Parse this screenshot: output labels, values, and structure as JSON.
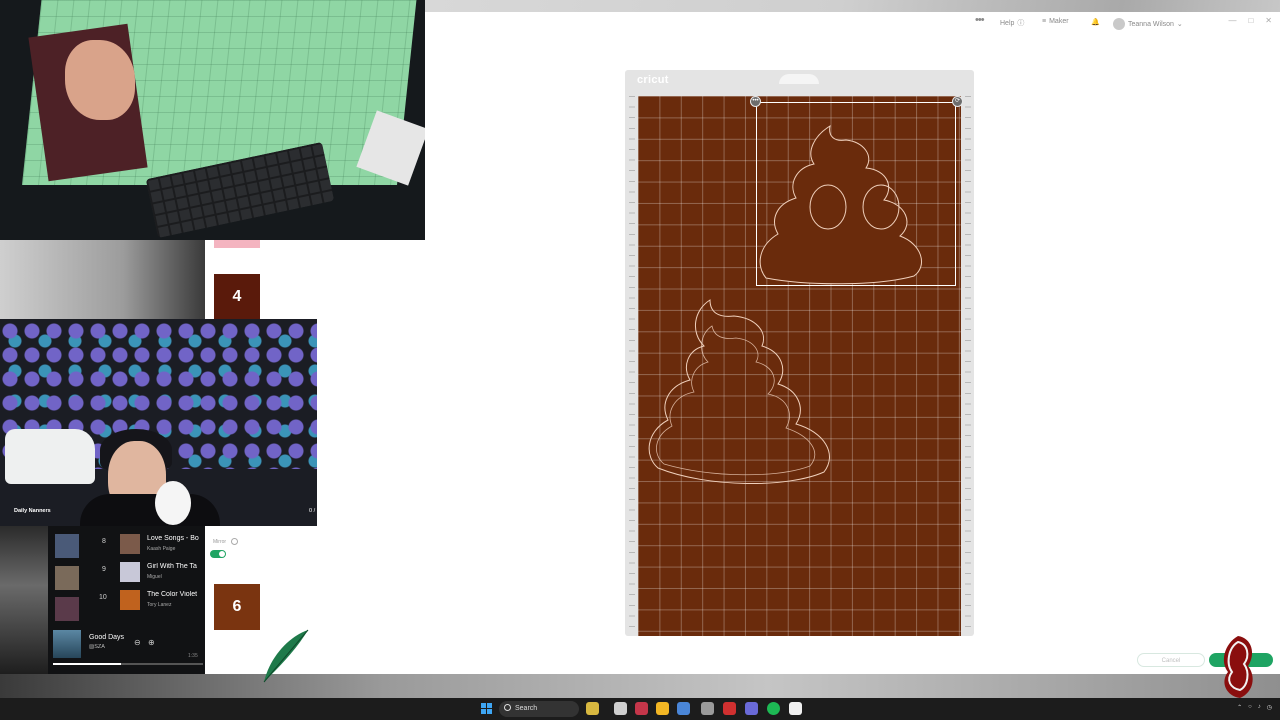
{
  "app": {
    "header": {
      "more_label": "•••",
      "help_label": "Help",
      "maker_label": "Maker",
      "user_name": "Teanna Wilson"
    },
    "mat": {
      "brand": "cricut"
    },
    "buttons": {
      "cancel": "Cancel",
      "continue": "Co"
    }
  },
  "left_panel": {
    "mat_thumbnails": [
      {
        "number": "4",
        "color": "#5a1a0b"
      },
      {
        "number": "6",
        "color": "#7a3410"
      }
    ],
    "toggle_label": "Mirror"
  },
  "webcam": {
    "name_label": "Daily Nanners",
    "counter": "0 /"
  },
  "spotify": {
    "tracks": [
      {
        "num": "8",
        "title": "Love Songs - Bo",
        "artist": "Kaash Paige"
      },
      {
        "num": "9",
        "title": "Girl With The Ta",
        "artist": "Miguel"
      },
      {
        "num": "10",
        "title": "The Color Violet",
        "artist": "Tory Lanez"
      }
    ],
    "now_playing": {
      "title": "Good Days",
      "artist": "SZA",
      "time": "1:35",
      "progress": 0.45
    }
  },
  "taskbar": {
    "search_label": "Search"
  },
  "colors": {
    "material": "#6a2b0c",
    "accent_green": "#1fa463"
  }
}
